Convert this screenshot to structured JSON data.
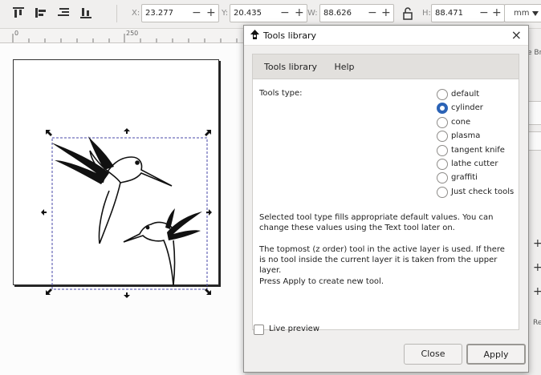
{
  "toolbar": {
    "x_label": "X:",
    "x_value": "23.277",
    "y_label": "Y:",
    "y_value": "20.435",
    "w_label": "W:",
    "w_value": "88.626",
    "h_label": "H:",
    "h_value": "88.471",
    "minus": "−",
    "plus": "+",
    "unit": "mm"
  },
  "ruler": {
    "ticks": [
      "0",
      "250"
    ]
  },
  "right_strip": {
    "partial_labels": [
      "e Br",
      "Re"
    ]
  },
  "dialog": {
    "title": "Tools library",
    "close_glyph": "×",
    "tabs": [
      {
        "label": "Tools library",
        "active": true
      },
      {
        "label": "Help",
        "active": false
      }
    ],
    "tools_type_label": "Tools type:",
    "options": [
      {
        "label": "default",
        "selected": false
      },
      {
        "label": "cylinder",
        "selected": true
      },
      {
        "label": "cone",
        "selected": false
      },
      {
        "label": "plasma",
        "selected": false
      },
      {
        "label": "tangent knife",
        "selected": false
      },
      {
        "label": "lathe cutter",
        "selected": false
      },
      {
        "label": "graffiti",
        "selected": false
      },
      {
        "label": "Just check tools",
        "selected": false
      }
    ],
    "para1": "Selected tool type fills appropriate default values. You can change these values using the Text tool later on.",
    "para2": "The topmost (z order) tool in the active layer is used. If there is no tool inside the current layer it is taken from the upper layer.",
    "para3": "Press Apply to create new tool.",
    "live_preview": "Live preview",
    "close_button": "Close",
    "apply_button": "Apply"
  },
  "colors": {
    "accent": "#2b63b6"
  }
}
